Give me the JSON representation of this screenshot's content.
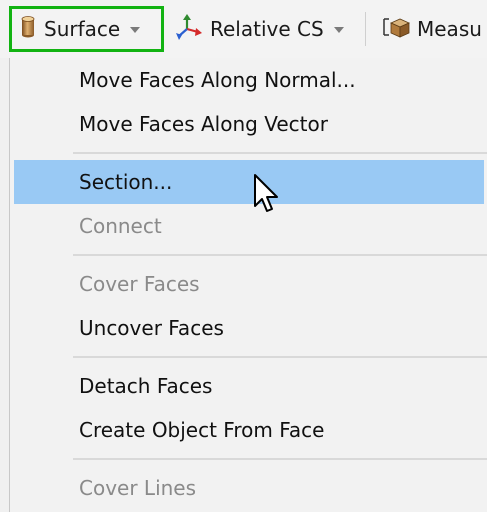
{
  "toolbar": {
    "surface": {
      "label": "Surface",
      "icon": "cylinder-surface-icon"
    },
    "relative_cs": {
      "label": "Relative CS",
      "icon": "coordinate-axes-icon"
    },
    "measure": {
      "label": "Measu",
      "icon": "measure-box-icon"
    }
  },
  "menu": {
    "items": [
      {
        "label": "Move Faces Along Normal...",
        "enabled": true
      },
      {
        "label": "Move Faces Along Vector",
        "enabled": true
      },
      {
        "label": "Section...",
        "enabled": true,
        "highlighted": true
      },
      {
        "label": "Connect",
        "enabled": false
      },
      {
        "label": "Cover Faces",
        "enabled": false
      },
      {
        "label": "Uncover Faces",
        "enabled": true
      },
      {
        "label": "Detach Faces",
        "enabled": true
      },
      {
        "label": "Create Object From Face",
        "enabled": true
      },
      {
        "label": "Cover Lines",
        "enabled": false
      }
    ]
  },
  "colors": {
    "highlight": "#99c9f4",
    "active_border": "#12b312",
    "disabled_text": "#8a8a8a"
  }
}
